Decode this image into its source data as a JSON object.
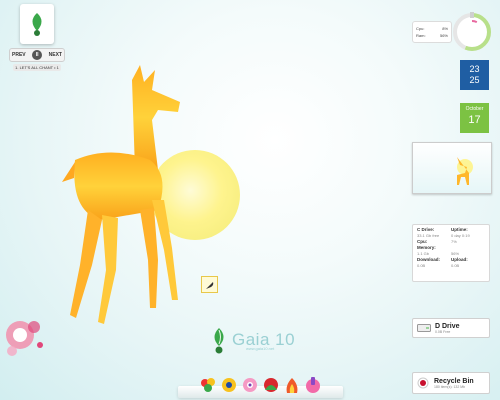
{
  "media_player": {
    "prev_label": "PREV",
    "next_label": "NEXT",
    "pause_symbol": "II",
    "track": "1. LET'S ALL CHANT • 1"
  },
  "system_gauge": {
    "cpu_label": "Cpu:",
    "cpu_value": "8%",
    "ram_label": "Ram:",
    "ram_value": "56%",
    "ring_color": "#b8e08a"
  },
  "clock": {
    "hour": "23",
    "minute": "25",
    "color": "#1f5ea3"
  },
  "calendar": {
    "month": "October",
    "day": "17",
    "color": "#7cc243"
  },
  "system_info": {
    "c_drive_label": "C Drive:",
    "c_drive_value": "33.1 Gb free",
    "uptime_label": "Uptime:",
    "uptime_value": "0 day 0:19",
    "cpu_label": "Cpu:",
    "cpu_value": "7%",
    "memory_label": "Memory:",
    "memory_value": "1.1 Gb",
    "memory_pct": "56%",
    "download_label": "Download:",
    "download_value": "0.0B",
    "upload_label": "Upload:",
    "upload_value": "0.0B"
  },
  "d_drive": {
    "title": "D Drive",
    "sub": "0.0B Free"
  },
  "recycle_bin": {
    "title": "Recycle Bin",
    "sub": "180 item(s): 132 Mb"
  },
  "logo": {
    "title": "Gaia 10",
    "url": "www.gaia10.net"
  },
  "dock_icons": [
    "flowers-icon",
    "sunflower-icon",
    "pink-flower-icon",
    "red-flower-icon",
    "fire-text-icon",
    "paint-icon"
  ]
}
